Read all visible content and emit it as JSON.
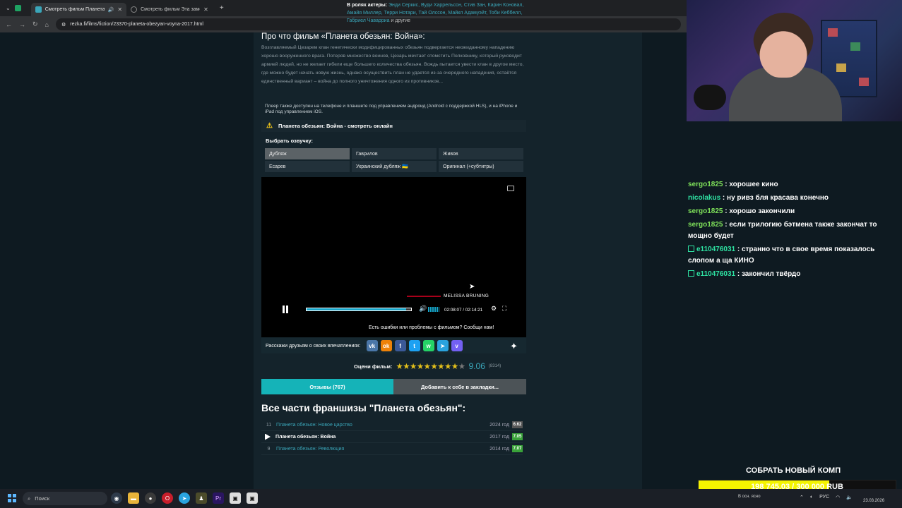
{
  "browser": {
    "tabs": [
      {
        "title": "Смотреть фильм Планета",
        "active": true
      },
      {
        "title": "Смотреть фильм Эта замечате",
        "active": false
      }
    ],
    "new_tab": "+",
    "url": "rezka.fi/films/fiction/23370-planeta-obezyan-voyna-2017.html"
  },
  "page": {
    "actors": {
      "label": "В ролях актеры:",
      "names": "Энди Серкис, Вуди Харрельсон, Стив Зан, Карин Коновал, Амайя Миллер, Терри Нотари, Тай Олссон, Майкл Адамуэйт, Тоби Кеббелл, Габриел Чаварриа",
      "suffix": " и другие"
    },
    "about_title": "Про что фильм «Планета обезьян: Война»:",
    "description": "Возглавляемый Цезарем клан генетически модифицированных обезьян подвергается неожиданному нападению хорошо вооруженного врага. Потеряв множество воинов, Цезарь мечтает отомстить Полковнику, который руководит армией людей, но не желает гибели еще большего количества обезьян. Вождь пытается увести клан в другое место, где можно будет начать новую жизнь, однако осуществить план не удается из-за очередного нападения, остаётся единственный вариант – война до полного уничтожения одного из противников...",
    "player_note": "Плеер также доступен на телефоне и планшете под управлением андроид (Android с поддержкой HLS), и на iPhone и iPad под управлением iOS.",
    "warning": "Планета обезьян: Война - смотреть онлайн",
    "voice_title": "Выбрать озвучку:",
    "voices": [
      "Дубляж",
      "Гаврилов",
      "Живов",
      "Есарев",
      "Украинский дубляж 🇺🇦",
      "Оригинал (+субтитры)"
    ],
    "selected_voice": "Дубляж",
    "player": {
      "credit": "MELISSA BRUNING",
      "time": "02:08:07 / 02:14:21",
      "progress": 0.953
    },
    "error_text": "Есть ошибки или проблемы с фильмом? Сообщи нам!",
    "share_text": "Расскажи друзьям о своих впечатлениях:",
    "socials": [
      {
        "name": "vk",
        "glyph": "vk",
        "color": "#4a76a8"
      },
      {
        "name": "ok",
        "glyph": "ok",
        "color": "#ee8208"
      },
      {
        "name": "facebook",
        "glyph": "f",
        "color": "#3b5998"
      },
      {
        "name": "twitter",
        "glyph": "t",
        "color": "#1da1f2"
      },
      {
        "name": "whatsapp",
        "glyph": "w",
        "color": "#25d366"
      },
      {
        "name": "telegram",
        "glyph": "➤",
        "color": "#2aa3de"
      },
      {
        "name": "viber",
        "glyph": "v",
        "color": "#7360f2"
      }
    ],
    "rating": {
      "label": "Оцени фильм:",
      "stars_on": "★★★★★★★★★",
      "stars_off": "★",
      "score": "9.06",
      "votes": "(8314)"
    },
    "reviews_button": "Отзывы (767)",
    "bookmark_button": "Добавить к себе в закладки...",
    "franchise_title": "Все части франшизы \"Планета обезьян\":",
    "franchise": [
      {
        "num": "11",
        "name": "Планета обезьян: Новое царство",
        "year": "2024 год",
        "score": "6.62",
        "current": false
      },
      {
        "num": "",
        "name": "Планета обезьян: Война",
        "year": "2017 год",
        "score": "7.05",
        "current": true
      },
      {
        "num": "9",
        "name": "Планета обезьян: Революция",
        "year": "2014 год",
        "score": "7.07",
        "current": false
      }
    ]
  },
  "chat": [
    {
      "user": "sergo1825",
      "text": " : хорошее кино",
      "color": "green",
      "badge": false
    },
    {
      "user": "nicolakus",
      "text": " : ну ривз бля красава конечно",
      "color": "teal",
      "badge": false
    },
    {
      "user": "sergo1825",
      "text": " : хорошо закончили",
      "color": "green",
      "badge": false
    },
    {
      "user": "sergo1825",
      "text": " : если трилогию бэтмена также закончат то мощно будет",
      "color": "green",
      "badge": false
    },
    {
      "user": "e110476031",
      "text": " : странно что в свое время показалось слопом а ща КИНО",
      "color": "teal",
      "badge": true
    },
    {
      "user": "e110476031",
      "text": " : закончил твёрдо",
      "color": "teal",
      "badge": true
    }
  ],
  "goal": {
    "title": "СОБРАТЬ НОВЫЙ КОМП",
    "amount": "198 745.03 / 300 000 RUB",
    "fraction": 0.6625
  },
  "taskbar": {
    "search": "Поиск",
    "weather": "В осн. ясно",
    "lang": "РУС",
    "date": "23.03.2026"
  }
}
